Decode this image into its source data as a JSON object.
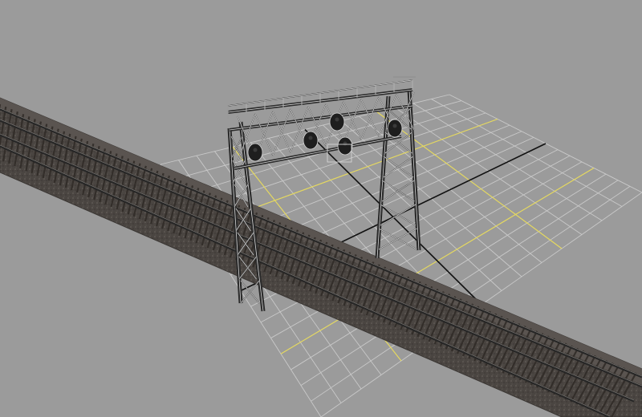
{
  "viewport": {
    "background_color": "#9b9b9b",
    "grid": {
      "enabled": true,
      "line_color": "#c9c9c9",
      "major_axis_color": "#e6d95a",
      "world_axis_color": "#111111"
    }
  },
  "scene": {
    "objects": [
      {
        "name": "railroad-track",
        "type": "double-track-ballast",
        "ballast_color": "#4a4541",
        "rail_color": "#262626",
        "tie_color": "#2f2a26"
      },
      {
        "name": "signal-gantry",
        "type": "signal-bridge",
        "material_color": "#2a2a2a",
        "wire_color": "#d4d4d4",
        "signal_heads": 4
      }
    ]
  }
}
